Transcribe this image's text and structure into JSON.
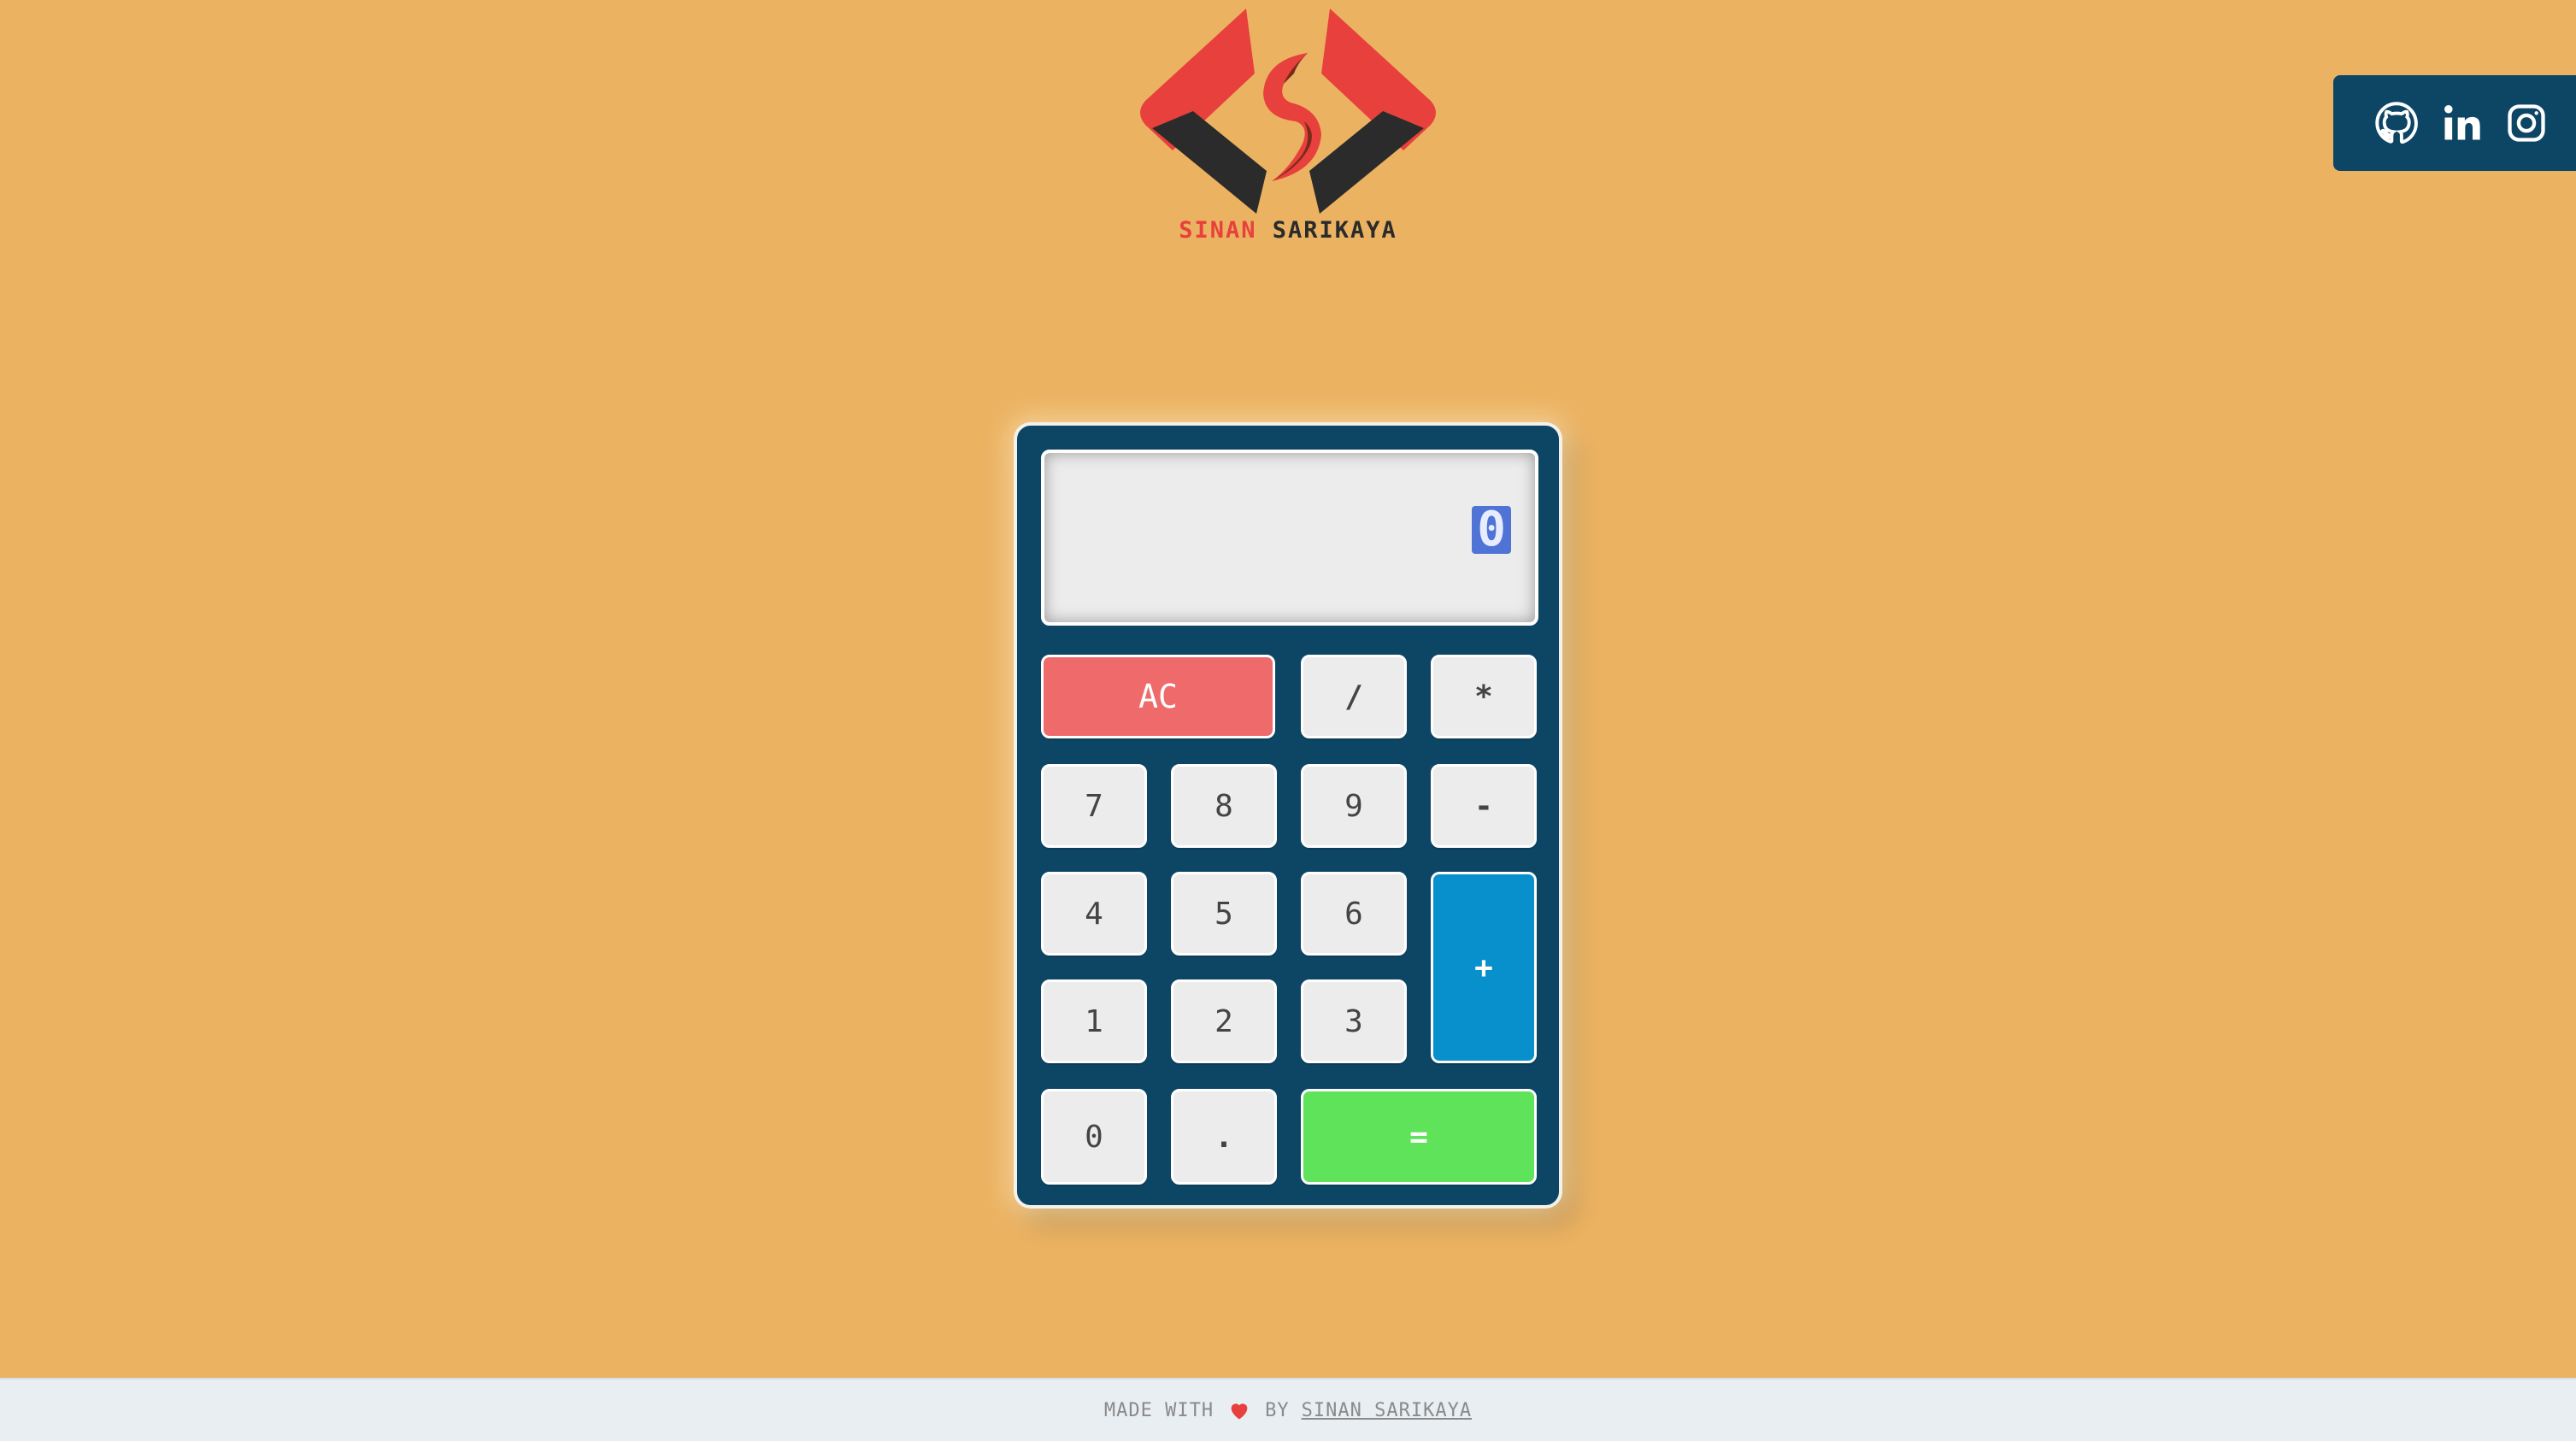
{
  "logo": {
    "first_name": "SINAN",
    "last_name": "SARIKAYA",
    "icon": "sinan-sarikaya-logo",
    "colors": {
      "red": "#e8403d",
      "dark": "#2b2b2b",
      "accent": "#7a2a1a"
    }
  },
  "social": {
    "items": [
      {
        "name": "github",
        "icon": "github-icon"
      },
      {
        "name": "linkedin",
        "icon": "linkedin-icon"
      },
      {
        "name": "instagram",
        "icon": "instagram-icon"
      }
    ],
    "background": "#0d4565"
  },
  "calculator": {
    "display_value": "0",
    "keys": {
      "ac": "AC",
      "divide": "/",
      "multiply": "*",
      "seven": "7",
      "eight": "8",
      "nine": "9",
      "minus": "-",
      "four": "4",
      "five": "5",
      "six": "6",
      "plus": "+",
      "one": "1",
      "two": "2",
      "three": "3",
      "zero": "0",
      "dot": ".",
      "equals": "="
    },
    "colors": {
      "body": "#0d4565",
      "ac": "#ef6b6b",
      "plus": "#0790cc",
      "equals": "#5fe35a",
      "key": "#ececec"
    }
  },
  "footer": {
    "made_with": "MADE WITH",
    "heart_icon": "heart-icon",
    "by": "BY",
    "author_link": "SINAN SARIKAYA"
  },
  "background": "#ebb262"
}
